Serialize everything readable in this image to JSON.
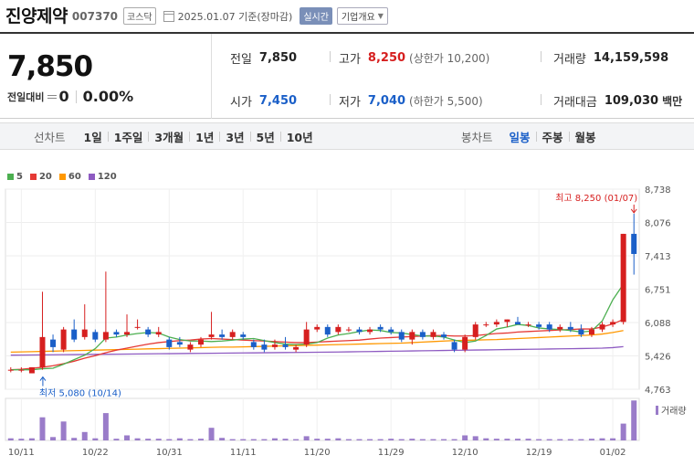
{
  "header": {
    "name": "진양제약",
    "code": "007370",
    "market": "코스닥",
    "date": "2025.01.07",
    "basis": "기준(장마감)",
    "realtime_label": "실시간",
    "company_label": "기업개요"
  },
  "summary": {
    "price": "7,850",
    "change_label": "전일대비",
    "change_value": "0",
    "change_pct": "0.00%",
    "prev_close_label": "전일",
    "prev_close": "7,850",
    "high_label": "고가",
    "high": "8,250",
    "upper_limit": "(상한가 10,200)",
    "volume_label": "거래량",
    "volume": "14,159,598",
    "open_label": "시가",
    "open": "7,450",
    "low_label": "저가",
    "low": "7,040",
    "lower_limit": "(하한가 5,500)",
    "amount_label": "거래대금",
    "amount": "109,030",
    "amount_unit": "백만"
  },
  "periods": {
    "label": "선차트",
    "items": [
      "1일",
      "1주일",
      "3개월",
      "1년",
      "3년",
      "5년",
      "10년"
    ],
    "candle_label": "봉차트",
    "candle_items": [
      "일봉",
      "주봉",
      "월봉"
    ],
    "active_candle": 0
  },
  "colors": {
    "up": "#d61f1f",
    "down": "#1a5fc8",
    "ma5": "#4caf50",
    "ma20": "#e53935",
    "ma60": "#ff9800",
    "ma120": "#8e5bc2",
    "volume": "#9a7cc9"
  },
  "chart_data": {
    "type": "candlestick",
    "legend": [
      {
        "name": "5",
        "color": "#4caf50"
      },
      {
        "name": "20",
        "color": "#e53935"
      },
      {
        "name": "60",
        "color": "#ff9800"
      },
      {
        "name": "120",
        "color": "#8e5bc2"
      }
    ],
    "y_ticks": [
      "8,738",
      "8,076",
      "7,413",
      "6,751",
      "6,088",
      "5,426",
      "4,763"
    ],
    "ylim": [
      4763,
      8738
    ],
    "x_ticks": [
      {
        "label": "10/11",
        "index": 1
      },
      {
        "label": "10/22",
        "index": 8
      },
      {
        "label": "10/31",
        "index": 15
      },
      {
        "label": "11/11",
        "index": 22
      },
      {
        "label": "11/20",
        "index": 29
      },
      {
        "label": "11/29",
        "index": 36
      },
      {
        "label": "12/10",
        "index": 43
      },
      {
        "label": "12/19",
        "index": 50
      },
      {
        "label": "01/02",
        "index": 57
      }
    ],
    "high_annotation": "최고 8,250 (01/07)",
    "low_annotation": "최저 5,080 (10/14)",
    "volume_label": "거래량",
    "candles": [
      {
        "o": 5150,
        "h": 5200,
        "l": 5100,
        "c": 5150,
        "v": 0.05
      },
      {
        "o": 5150,
        "h": 5200,
        "l": 5100,
        "c": 5150,
        "v": 0.04
      },
      {
        "o": 5080,
        "h": 5200,
        "l": 5080,
        "c": 5200,
        "v": 0.05
      },
      {
        "o": 5200,
        "h": 6700,
        "l": 5150,
        "c": 5800,
        "v": 0.55
      },
      {
        "o": 5750,
        "h": 5850,
        "l": 5500,
        "c": 5600,
        "v": 0.08
      },
      {
        "o": 5550,
        "h": 6000,
        "l": 5500,
        "c": 5950,
        "v": 0.45
      },
      {
        "o": 5950,
        "h": 6150,
        "l": 5700,
        "c": 5750,
        "v": 0.06
      },
      {
        "o": 5800,
        "h": 6450,
        "l": 5750,
        "c": 5950,
        "v": 0.2
      },
      {
        "o": 5900,
        "h": 5950,
        "l": 5700,
        "c": 5750,
        "v": 0.05
      },
      {
        "o": 5750,
        "h": 7100,
        "l": 5700,
        "c": 5900,
        "v": 0.65
      },
      {
        "o": 5900,
        "h": 5950,
        "l": 5800,
        "c": 5850,
        "v": 0.04
      },
      {
        "o": 5850,
        "h": 6250,
        "l": 5800,
        "c": 5900,
        "v": 0.12
      },
      {
        "o": 6000,
        "h": 6150,
        "l": 5950,
        "c": 6000,
        "v": 0.05
      },
      {
        "o": 5950,
        "h": 6000,
        "l": 5800,
        "c": 5850,
        "v": 0.04
      },
      {
        "o": 5850,
        "h": 6000,
        "l": 5800,
        "c": 5900,
        "v": 0.04
      },
      {
        "o": 5750,
        "h": 5800,
        "l": 5550,
        "c": 5600,
        "v": 0.03
      },
      {
        "o": 5700,
        "h": 5800,
        "l": 5600,
        "c": 5650,
        "v": 0.05
      },
      {
        "o": 5550,
        "h": 5700,
        "l": 5500,
        "c": 5650,
        "v": 0.03
      },
      {
        "o": 5650,
        "h": 5800,
        "l": 5600,
        "c": 5750,
        "v": 0.04
      },
      {
        "o": 5800,
        "h": 6300,
        "l": 5750,
        "c": 5850,
        "v": 0.3
      },
      {
        "o": 5850,
        "h": 5950,
        "l": 5750,
        "c": 5800,
        "v": 0.06
      },
      {
        "o": 5800,
        "h": 5950,
        "l": 5750,
        "c": 5900,
        "v": 0.03
      },
      {
        "o": 5850,
        "h": 5900,
        "l": 5750,
        "c": 5800,
        "v": 0.03
      },
      {
        "o": 5700,
        "h": 5750,
        "l": 5550,
        "c": 5600,
        "v": 0.03
      },
      {
        "o": 5650,
        "h": 5750,
        "l": 5500,
        "c": 5550,
        "v": 0.03
      },
      {
        "o": 5600,
        "h": 5750,
        "l": 5550,
        "c": 5650,
        "v": 0.05
      },
      {
        "o": 5650,
        "h": 5800,
        "l": 5550,
        "c": 5600,
        "v": 0.04
      },
      {
        "o": 5550,
        "h": 5650,
        "l": 5500,
        "c": 5600,
        "v": 0.03
      },
      {
        "o": 5650,
        "h": 6100,
        "l": 5600,
        "c": 5950,
        "v": 0.1
      },
      {
        "o": 5950,
        "h": 6050,
        "l": 5900,
        "c": 6000,
        "v": 0.04
      },
      {
        "o": 6000,
        "h": 6050,
        "l": 5800,
        "c": 5850,
        "v": 0.04
      },
      {
        "o": 5900,
        "h": 6050,
        "l": 5850,
        "c": 6000,
        "v": 0.05
      },
      {
        "o": 5950,
        "h": 6000,
        "l": 5900,
        "c": 5950,
        "v": 0.03
      },
      {
        "o": 5950,
        "h": 6000,
        "l": 5850,
        "c": 5900,
        "v": 0.03
      },
      {
        "o": 5900,
        "h": 6000,
        "l": 5850,
        "c": 5950,
        "v": 0.03
      },
      {
        "o": 6000,
        "h": 6050,
        "l": 5900,
        "c": 5950,
        "v": 0.03
      },
      {
        "o": 5950,
        "h": 6000,
        "l": 5850,
        "c": 5900,
        "v": 0.04
      },
      {
        "o": 5900,
        "h": 5950,
        "l": 5700,
        "c": 5750,
        "v": 0.03
      },
      {
        "o": 5750,
        "h": 5950,
        "l": 5650,
        "c": 5900,
        "v": 0.04
      },
      {
        "o": 5900,
        "h": 5950,
        "l": 5750,
        "c": 5800,
        "v": 0.03
      },
      {
        "o": 5800,
        "h": 5950,
        "l": 5750,
        "c": 5900,
        "v": 0.03
      },
      {
        "o": 5850,
        "h": 5900,
        "l": 5750,
        "c": 5800,
        "v": 0.03
      },
      {
        "o": 5700,
        "h": 5750,
        "l": 5500,
        "c": 5550,
        "v": 0.03
      },
      {
        "o": 5550,
        "h": 5850,
        "l": 5500,
        "c": 5800,
        "v": 0.12
      },
      {
        "o": 5800,
        "h": 6100,
        "l": 5750,
        "c": 6050,
        "v": 0.1
      },
      {
        "o": 6050,
        "h": 6100,
        "l": 6000,
        "c": 6050,
        "v": 0.05
      },
      {
        "o": 6050,
        "h": 6150,
        "l": 6000,
        "c": 6100,
        "v": 0.04
      },
      {
        "o": 6100,
        "h": 6150,
        "l": 6000,
        "c": 6150,
        "v": 0.04
      },
      {
        "o": 6100,
        "h": 6200,
        "l": 6050,
        "c": 6050,
        "v": 0.04
      },
      {
        "o": 6050,
        "h": 6100,
        "l": 6000,
        "c": 6050,
        "v": 0.04
      },
      {
        "o": 6050,
        "h": 6100,
        "l": 5950,
        "c": 6000,
        "v": 0.03
      },
      {
        "o": 6050,
        "h": 6100,
        "l": 5900,
        "c": 5950,
        "v": 0.03
      },
      {
        "o": 5950,
        "h": 6050,
        "l": 5900,
        "c": 6000,
        "v": 0.03
      },
      {
        "o": 6000,
        "h": 6100,
        "l": 5900,
        "c": 5950,
        "v": 0.03
      },
      {
        "o": 5950,
        "h": 6050,
        "l": 5800,
        "c": 5850,
        "v": 0.03
      },
      {
        "o": 5850,
        "h": 6000,
        "l": 5800,
        "c": 5950,
        "v": 0.04
      },
      {
        "o": 5950,
        "h": 6100,
        "l": 5900,
        "c": 6050,
        "v": 0.05
      },
      {
        "o": 6050,
        "h": 6150,
        "l": 6000,
        "c": 6100,
        "v": 0.05
      },
      {
        "o": 6100,
        "h": 7850,
        "l": 6050,
        "c": 7850,
        "v": 0.4
      },
      {
        "o": 7850,
        "h": 8250,
        "l": 7040,
        "c": 7450,
        "v": 0.95
      }
    ],
    "ma5": [
      5150,
      5150,
      5150,
      5170,
      5180,
      5260,
      5350,
      5440,
      5570,
      5780,
      5800,
      5840,
      5870,
      5890,
      5880,
      5800,
      5750,
      5720,
      5720,
      5710,
      5720,
      5740,
      5760,
      5770,
      5730,
      5690,
      5660,
      5650,
      5660,
      5690,
      5780,
      5840,
      5870,
      5910,
      5940,
      5930,
      5890,
      5880,
      5850,
      5820,
      5820,
      5800,
      5740,
      5690,
      5720,
      5830,
      5960,
      6000,
      6050,
      6030,
      5980,
      5960,
      5950,
      5930,
      5900,
      5920,
      6120,
      6540,
      6850
    ],
    "ma20": [
      5150,
      5160,
      5180,
      5200,
      5230,
      5270,
      5320,
      5380,
      5430,
      5490,
      5540,
      5580,
      5620,
      5660,
      5690,
      5710,
      5730,
      5740,
      5760,
      5770,
      5760,
      5750,
      5740,
      5730,
      5720,
      5710,
      5700,
      5690,
      5690,
      5700,
      5710,
      5720,
      5730,
      5740,
      5760,
      5780,
      5790,
      5800,
      5810,
      5820,
      5830,
      5830,
      5820,
      5820,
      5830,
      5850,
      5870,
      5880,
      5900,
      5910,
      5920,
      5930,
      5940,
      5950,
      5960,
      5960,
      6000,
      6060,
      6150
    ],
    "ma60": [
      5500,
      5505,
      5510,
      5515,
      5520,
      5525,
      5530,
      5535,
      5540,
      5545,
      5550,
      5555,
      5560,
      5565,
      5570,
      5575,
      5580,
      5585,
      5590,
      5595,
      5600,
      5600,
      5605,
      5610,
      5615,
      5620,
      5625,
      5630,
      5635,
      5640,
      5645,
      5650,
      5655,
      5660,
      5665,
      5670,
      5675,
      5680,
      5690,
      5700,
      5710,
      5720,
      5730,
      5735,
      5740,
      5745,
      5750,
      5760,
      5770,
      5780,
      5790,
      5800,
      5810,
      5820,
      5830,
      5840,
      5860,
      5890,
      5930
    ],
    "ma120": [
      5440,
      5442,
      5444,
      5446,
      5448,
      5450,
      5452,
      5454,
      5456,
      5458,
      5460,
      5462,
      5464,
      5466,
      5468,
      5470,
      5472,
      5474,
      5476,
      5478,
      5480,
      5482,
      5484,
      5486,
      5488,
      5490,
      5492,
      5494,
      5496,
      5498,
      5500,
      5503,
      5506,
      5509,
      5512,
      5515,
      5518,
      5521,
      5524,
      5527,
      5530,
      5533,
      5536,
      5539,
      5542,
      5545,
      5548,
      5551,
      5554,
      5557,
      5560,
      5563,
      5566,
      5569,
      5572,
      5575,
      5580,
      5590,
      5610
    ]
  }
}
